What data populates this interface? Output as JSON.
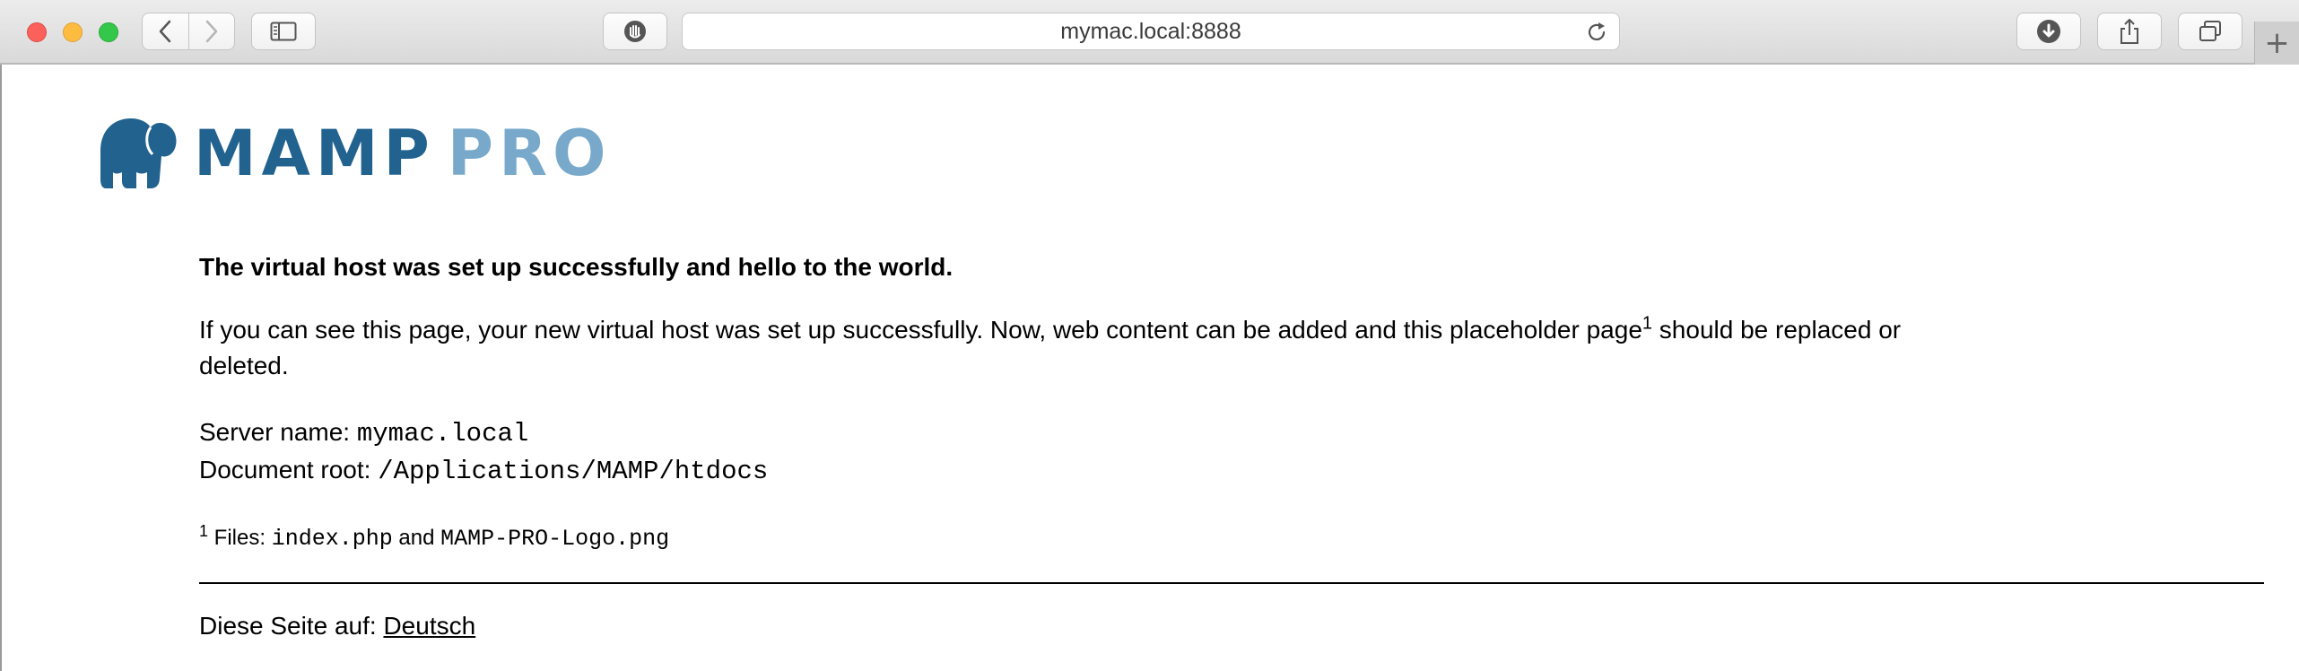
{
  "browser": {
    "url": "mymac.local:8888",
    "icons": {
      "back": "chevron-left-icon",
      "forward": "chevron-right-icon",
      "sidebar": "sidebar-icon",
      "privacy": "hand-shield-icon",
      "reload": "reload-icon",
      "download": "download-icon",
      "share": "share-icon",
      "tabs": "tabs-overview-icon",
      "new_tab": "plus-icon"
    },
    "new_tab_glyph": "+"
  },
  "logo": {
    "part1": "MAMP",
    "part2": "PRO",
    "color_dark": "#21628f",
    "color_light": "#78a9cb"
  },
  "page": {
    "heading": "The virtual host was set up successfully and hello to the world.",
    "intro_before": "If you can see this page, your new virtual host was set up successfully. Now, web content can be added and this placeholder page",
    "intro_sup": "1",
    "intro_after": " should be replaced or deleted.",
    "server_label": "Server name: ",
    "server_value": "mymac.local",
    "docroot_label": "Document root: ",
    "docroot_value": "/Applications/MAMP/htdocs",
    "footnote_marker": "1",
    "footnote_label": " Files: ",
    "footnote_file1": "index.php",
    "footnote_and": " and ",
    "footnote_file2": "MAMP-PRO-Logo.png",
    "lang_label": "Diese Seite auf: ",
    "lang_link": "Deutsch"
  }
}
